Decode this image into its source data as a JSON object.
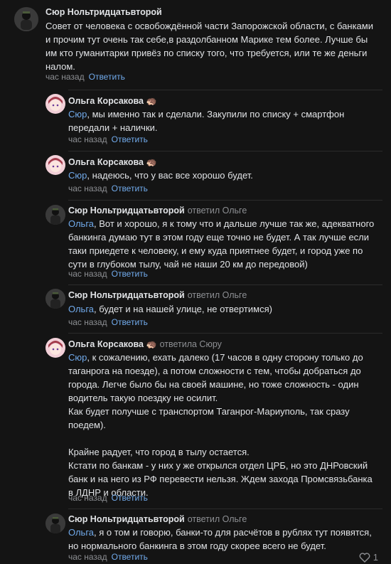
{
  "comments": [
    {
      "author": "Сюр Нольтридцатьвторой",
      "text": "Совет от человека с освобождённой части Запорожской области, с банками и прочим тут очень так себе,в раздолбанном Марике тем более. Лучше бы им кто гуманитарки привёз по списку того, что требуется, или те же деньги налом.",
      "time": "час назад",
      "reply": "Ответить"
    },
    {
      "author": "Ольга Корсакова",
      "emoji": "🦔",
      "mention": "Сюр",
      "text": ", мы именно так и сделали. Закупили по списку + смартфон передали + налички.",
      "time": "час назад",
      "reply": "Ответить"
    },
    {
      "author": "Ольга Корсакова",
      "emoji": "🦔",
      "mention": "Сюр",
      "text": ", надеюсь, что у вас все хорошо будет.",
      "time": "час назад",
      "reply": "Ответить"
    },
    {
      "author": "Сюр Нольтридцатьвторой",
      "replied_to": "ответил Ольге",
      "mention": "Ольга",
      "text": ", Вот и хорошо, я к тому что и дальше лучше так же, адекватного банкинга думаю тут в этом году еще точно не будет. А так лучше если таки приедете к человеку, и ему куда приятнее будет, и город уже по сути в глубоком тылу, чай не наши 20 км до передовой)",
      "time": "час назад",
      "reply": "Ответить"
    },
    {
      "author": "Сюр Нольтридцатьвторой",
      "replied_to": "ответил Ольге",
      "mention": "Ольга",
      "text": ", будет и на нашей улице, не отвертимся)",
      "time": "час назад",
      "reply": "Ответить"
    },
    {
      "author": "Ольга Корсакова",
      "emoji": "🦔",
      "replied_to": "ответила Сюру",
      "mention": "Сюр",
      "text": ", к сожалению, ехать далеко (17 часов в одну сторону только до таганрога на поезде), а потом сложности с тем, чтобы добраться до города. Легче было бы на своей машине, но тоже сложность - один водитель такую поездку не осилит.",
      "text2": "Как будет получше с транспортом Таганрог-Мариуполь, так сразу поедем).",
      "text3": "Крайне радует, что город в тылу остается.",
      "text4": "Кстати по банкам - у них у же открылся отдел ЦРБ, но это ДНРовский банк и на него из РФ перевести нельзя. Ждем захода Промсвязьбанка в ЛДНР и области.",
      "time": "час назад",
      "reply": "Ответить"
    },
    {
      "author": "Сюр Нольтридцатьвторой",
      "replied_to": "ответил Ольге",
      "mention": "Ольга",
      "text": ", я о том и говорю, банки-то для расчётов в рублях тут появятся, но нормального банкинга в этом году скорее всего не будет.",
      "time": "час назад",
      "reply": "Ответить",
      "likes": "1"
    }
  ],
  "colors": {
    "background": "#141414",
    "link": "#71aaeb",
    "muted": "#8d8f93"
  },
  "icons": {
    "like": "heart-icon"
  }
}
